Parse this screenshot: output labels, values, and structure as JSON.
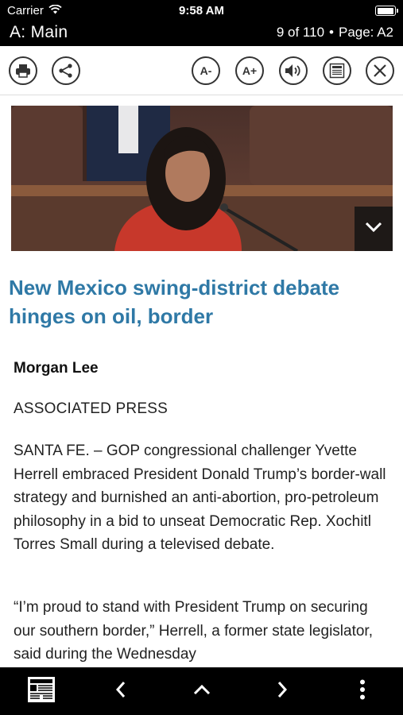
{
  "status_bar": {
    "carrier": "Carrier",
    "time": "9:58 AM",
    "battery_level": 1.0,
    "wifi_icon": "wifi-icon"
  },
  "section_header": {
    "section": "A: Main",
    "position": "9 of 110",
    "separator": "•",
    "page": "Page: A2"
  },
  "toolbar": {
    "print_icon": "printer-icon",
    "share_icon": "share-icon",
    "font_decrease_label": "A-",
    "font_increase_label": "A+",
    "audio_icon": "speaker-icon",
    "page_view_icon": "newspaper-page-icon",
    "close_icon": "close-icon"
  },
  "article": {
    "photo_expand_icon": "chevron-down-icon",
    "headline": "New Mexico swing-district debate hinges on oil, border",
    "author": "Morgan Lee",
    "agency": "ASSOCIATED PRESS",
    "paragraphs": [
      "SANTA FE. – GOP congressional challenger Yvette Herrell embraced President Donald Trump’s border-wall strategy and burnished an anti-abortion, pro-petroleum philosophy in a bid to unseat Democratic Rep. Xochitl Torres Small during a televised debate.",
      "“I’m proud to stand with President Trump on securing our southern border,” Herrell, a former state legislator, said during the Wednesday"
    ]
  },
  "bottom_bar": {
    "pages_icon": "page-thumbnails-icon",
    "prev_icon": "chevron-left-icon",
    "up_icon": "chevron-up-icon",
    "next_icon": "chevron-right-icon",
    "more_icon": "more-vertical-icon"
  },
  "colors": {
    "headline": "#2f79a6",
    "bars": "#000000"
  }
}
